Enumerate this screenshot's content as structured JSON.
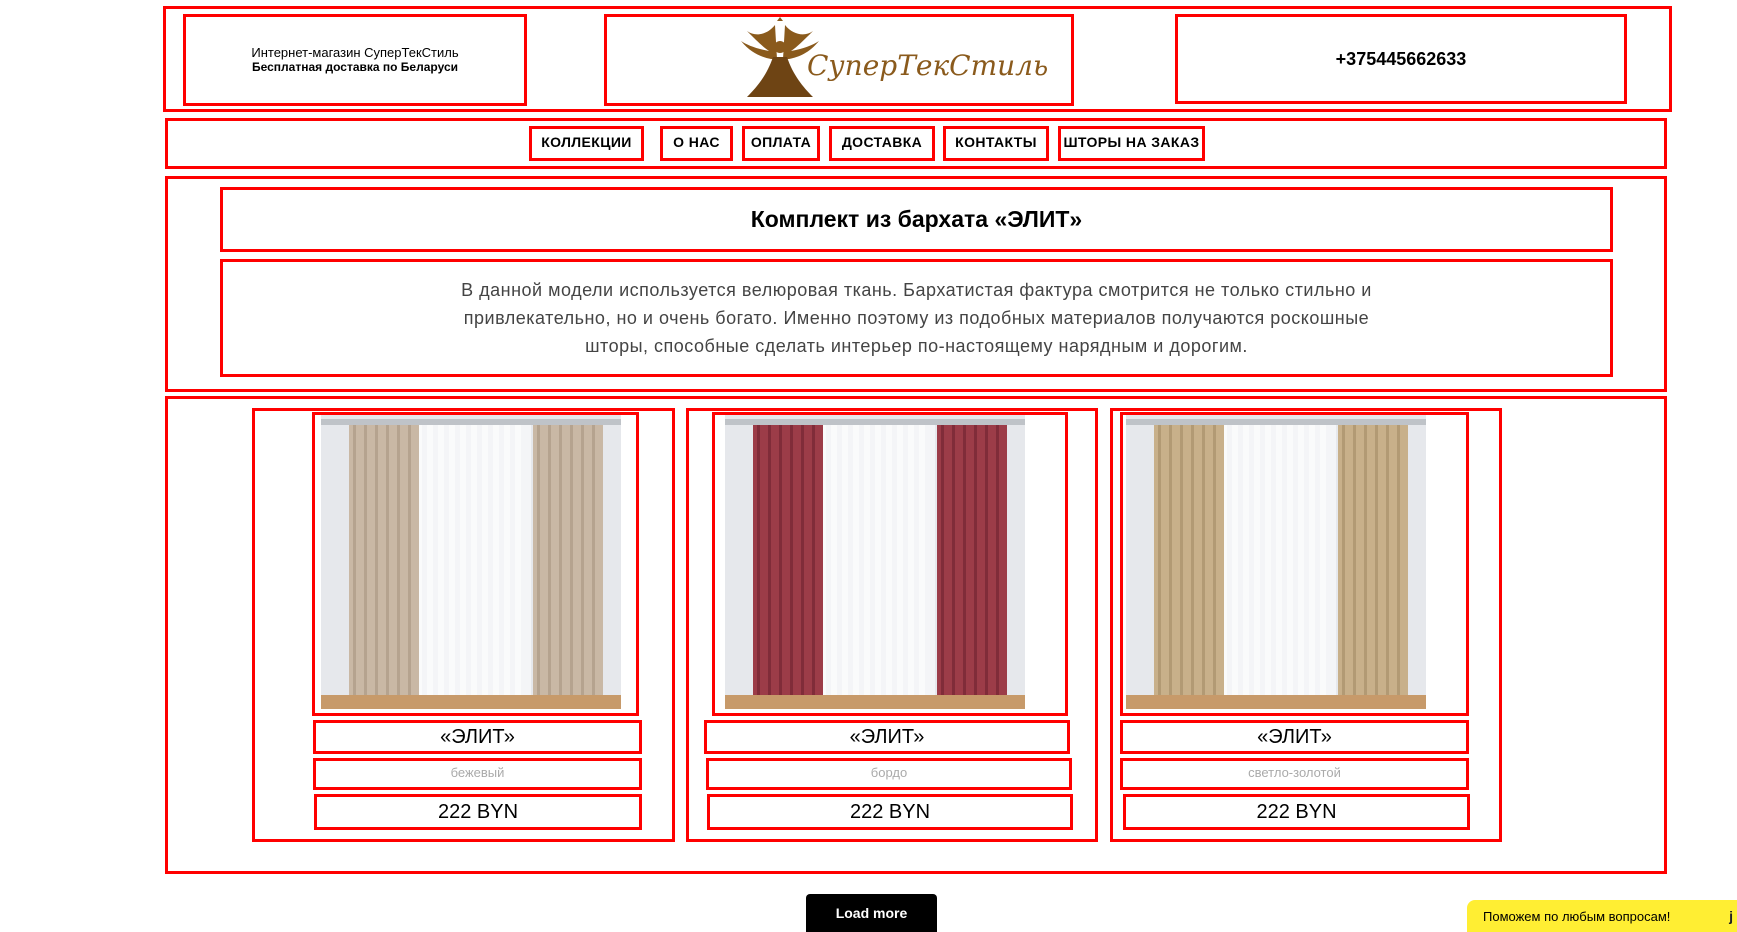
{
  "header": {
    "shop_line": "Интернет-магазин СуперТекСтиль",
    "delivery_line": "Бесплатная доставка по Беларуси",
    "logo_text": "СуперТекСтиль",
    "phone": "+375445662633"
  },
  "nav": {
    "items": [
      {
        "label": "КОЛЛЕКЦИИ"
      },
      {
        "label": "О НАС"
      },
      {
        "label": "ОПЛАТА"
      },
      {
        "label": "ДОСТАВКА"
      },
      {
        "label": "КОНТАКТЫ"
      },
      {
        "label": "ШТОРЫ НА ЗАКАЗ"
      }
    ]
  },
  "intro": {
    "title": "Комплект из бархата «ЭЛИТ»",
    "description": "В данной модели используется велюровая ткань. Бархатистая фактура смотрится не только стильно и привлекательно, но и очень богато. Именно поэтому из подобных материалов получаются роскошные шторы, способные сделать интерьер по-настоящему нарядным и дорогим."
  },
  "products": [
    {
      "name": "«ЭЛИТ»",
      "color": "бежевый",
      "price": "222 BYN",
      "curtain_color": "#c9b8a5",
      "curtain_shade": "#a89480"
    },
    {
      "name": "«ЭЛИТ»",
      "color": "бордо",
      "price": "222 BYN",
      "curtain_color": "#9c3c48",
      "curtain_shade": "#6e2230"
    },
    {
      "name": "«ЭЛИТ»",
      "color": "светло-золотой",
      "price": "222 BYN",
      "curtain_color": "#c8b08a",
      "curtain_shade": "#a38c66"
    }
  ],
  "load_more_label": "Load more",
  "chat": {
    "label": "Поможем по любым вопросам!",
    "icon": "jivo-chat-icon"
  },
  "colors": {
    "annotation_border": "#ff0000",
    "logo_gold": "#8a5a1c",
    "button_bg": "#000000",
    "chat_bg": "#ffee33"
  }
}
